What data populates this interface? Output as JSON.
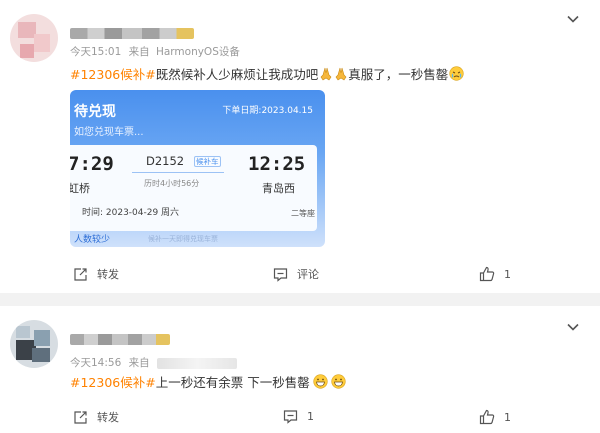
{
  "posts": [
    {
      "time": "今天15:01",
      "source_prefix": "来自",
      "source": "HarmonyOS设备",
      "topic": "#12306候补#",
      "text": "既然候补人少麻烦让我成功吧",
      "text2": "真服了，一秒售罄",
      "emoji": [
        "pray-icon",
        "pray-icon",
        "crying-face-icon"
      ],
      "card": {
        "title": "待兑现",
        "subtitle": "如您兑现车票...",
        "order_date": "下单日期:2023.04.15",
        "depart_time": "7:29",
        "depart_station": "虹桥",
        "train": "D2152",
        "train_tag": "候补车",
        "duration": "历时4小时56分",
        "arrive_time": "12:25",
        "arrive_station": "青岛西",
        "depart_date": "时间: 2023-04-29 周六",
        "seat": "二等座",
        "footer": "人数较少",
        "footer_note": "候补一天即得兑现车票"
      },
      "actions": {
        "repost": "转发",
        "comment": "评论",
        "likes": "1"
      }
    },
    {
      "time": "今天14:56",
      "source_prefix": "来自",
      "topic": "#12306候补#",
      "text": "上一秒还有余票 下一秒售罄",
      "emoji": [
        "grinning-face-icon",
        "grinning-face-icon"
      ],
      "actions": {
        "repost": "转发",
        "comments": "1",
        "likes": "1"
      }
    }
  ],
  "colors": {
    "topic": "#ff8200",
    "card_blue": "#4a90ee",
    "background": "#f2f2f2"
  }
}
